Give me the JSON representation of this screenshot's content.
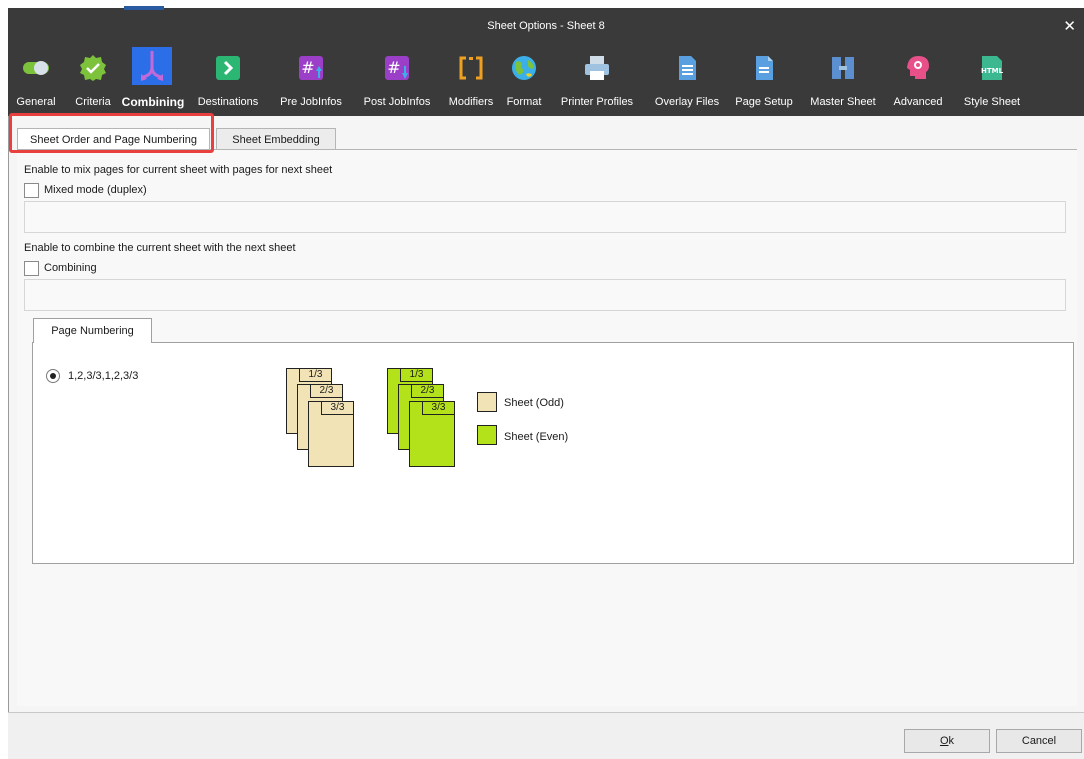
{
  "window": {
    "title": "Sheet Options - Sheet 8",
    "close_glyph": "✕"
  },
  "toolbar": [
    {
      "label": "General",
      "icon": "toggle-icon",
      "color": "#7cc23a"
    },
    {
      "label": "Criteria",
      "icon": "check-badge-icon",
      "color": "#7cc23a"
    },
    {
      "label": "Combining",
      "icon": "merge-arrows-icon",
      "color": "#2b6ee8"
    },
    {
      "label": "Destinations",
      "icon": "arrow-right-box-icon",
      "color": "#2bb673"
    },
    {
      "label": "Pre JobInfos",
      "icon": "hash-up-icon",
      "color": "#9b3fc8"
    },
    {
      "label": "Post JobInfos",
      "icon": "hash-down-icon",
      "color": "#9b3fc8"
    },
    {
      "label": "Modifiers",
      "icon": "brackets-icon",
      "color": "#f0a020"
    },
    {
      "label": "Format",
      "icon": "globe-icon",
      "color": "#3bb0e8"
    },
    {
      "label": "Printer Profiles",
      "icon": "printer-icon",
      "color": "#9ec2e0"
    },
    {
      "label": "Overlay Files",
      "icon": "document-icon",
      "color": "#5aa0e0"
    },
    {
      "label": "Page Setup",
      "icon": "page-icon",
      "color": "#5aa0e0"
    },
    {
      "label": "Master Sheet",
      "icon": "master-sheet-icon",
      "color": "#5b8fd0"
    },
    {
      "label": "Advanced",
      "icon": "gear-head-icon",
      "color": "#e8508a"
    },
    {
      "label": "Style Sheet",
      "icon": "html-file-icon",
      "color": "#3bb890",
      "text": "HTML"
    }
  ],
  "tabs": {
    "sheet_order": "Sheet Order and Page Numbering",
    "sheet_embedding": "Sheet Embedding"
  },
  "mixed": {
    "description": "Enable to mix pages for current sheet with pages for next sheet",
    "checkbox_label": "Mixed mode (duplex)"
  },
  "combine": {
    "description": "Enable to combine the current sheet with the next sheet",
    "checkbox_label": "Combining"
  },
  "page_numbering": {
    "tab_label": "Page Numbering",
    "radio_label": "1,2,3/3,1,2,3/3",
    "odd_pages": [
      "1/3",
      "2/3",
      "3/3"
    ],
    "even_pages": [
      "1/3",
      "2/3",
      "3/3"
    ],
    "legend_odd": "Sheet (Odd)",
    "legend_even": "Sheet (Even)",
    "odd_color": "#f1e3b6",
    "even_color": "#b4e21a"
  },
  "buttons": {
    "ok_underline": "O",
    "ok_rest": "k",
    "cancel": "Cancel"
  }
}
